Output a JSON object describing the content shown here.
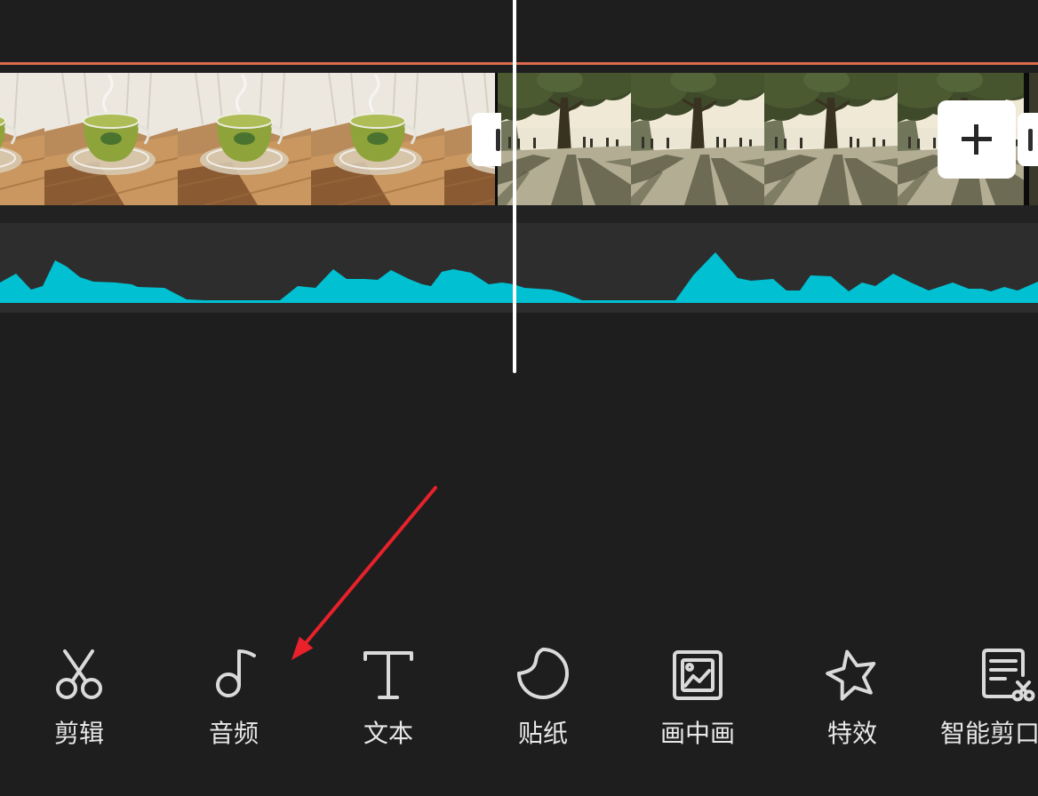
{
  "colors": {
    "background": "#1e1e1e",
    "marker_line": "#dc6b4f",
    "playhead": "#ffffff",
    "waveform": "#00c0d2",
    "audio_track": "#2d2d2d",
    "annotation_arrow": "#e8212b",
    "toolbar_icon": "#dadada",
    "toolbar_text": "#e8e8e8"
  },
  "timeline": {
    "add_button_icon": "plus-icon",
    "trim_handle_icon": "trim-handle-icon"
  },
  "toolbar": {
    "items": [
      {
        "label": "剪辑",
        "icon": "scissors-icon"
      },
      {
        "label": "音频",
        "icon": "music-note-icon"
      },
      {
        "label": "文本",
        "icon": "text-icon"
      },
      {
        "label": "贴纸",
        "icon": "sticker-icon"
      },
      {
        "label": "画中画",
        "icon": "picture-in-picture-icon"
      },
      {
        "label": "特效",
        "icon": "effects-star-icon"
      },
      {
        "label": "智能剪口",
        "icon": "smart-cut-icon"
      }
    ]
  }
}
